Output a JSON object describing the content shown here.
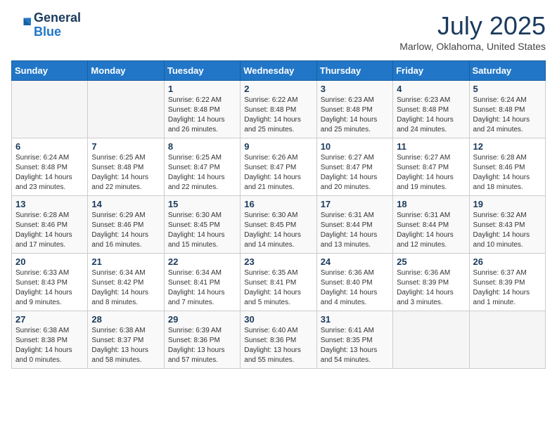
{
  "logo": {
    "text1": "General",
    "text2": "Blue"
  },
  "title": "July 2025",
  "location": "Marlow, Oklahoma, United States",
  "days_of_week": [
    "Sunday",
    "Monday",
    "Tuesday",
    "Wednesday",
    "Thursday",
    "Friday",
    "Saturday"
  ],
  "weeks": [
    [
      {
        "day": "",
        "info": ""
      },
      {
        "day": "",
        "info": ""
      },
      {
        "day": "1",
        "info": "Sunrise: 6:22 AM\nSunset: 8:48 PM\nDaylight: 14 hours and 26 minutes."
      },
      {
        "day": "2",
        "info": "Sunrise: 6:22 AM\nSunset: 8:48 PM\nDaylight: 14 hours and 25 minutes."
      },
      {
        "day": "3",
        "info": "Sunrise: 6:23 AM\nSunset: 8:48 PM\nDaylight: 14 hours and 25 minutes."
      },
      {
        "day": "4",
        "info": "Sunrise: 6:23 AM\nSunset: 8:48 PM\nDaylight: 14 hours and 24 minutes."
      },
      {
        "day": "5",
        "info": "Sunrise: 6:24 AM\nSunset: 8:48 PM\nDaylight: 14 hours and 24 minutes."
      }
    ],
    [
      {
        "day": "6",
        "info": "Sunrise: 6:24 AM\nSunset: 8:48 PM\nDaylight: 14 hours and 23 minutes."
      },
      {
        "day": "7",
        "info": "Sunrise: 6:25 AM\nSunset: 8:48 PM\nDaylight: 14 hours and 22 minutes."
      },
      {
        "day": "8",
        "info": "Sunrise: 6:25 AM\nSunset: 8:47 PM\nDaylight: 14 hours and 22 minutes."
      },
      {
        "day": "9",
        "info": "Sunrise: 6:26 AM\nSunset: 8:47 PM\nDaylight: 14 hours and 21 minutes."
      },
      {
        "day": "10",
        "info": "Sunrise: 6:27 AM\nSunset: 8:47 PM\nDaylight: 14 hours and 20 minutes."
      },
      {
        "day": "11",
        "info": "Sunrise: 6:27 AM\nSunset: 8:47 PM\nDaylight: 14 hours and 19 minutes."
      },
      {
        "day": "12",
        "info": "Sunrise: 6:28 AM\nSunset: 8:46 PM\nDaylight: 14 hours and 18 minutes."
      }
    ],
    [
      {
        "day": "13",
        "info": "Sunrise: 6:28 AM\nSunset: 8:46 PM\nDaylight: 14 hours and 17 minutes."
      },
      {
        "day": "14",
        "info": "Sunrise: 6:29 AM\nSunset: 8:46 PM\nDaylight: 14 hours and 16 minutes."
      },
      {
        "day": "15",
        "info": "Sunrise: 6:30 AM\nSunset: 8:45 PM\nDaylight: 14 hours and 15 minutes."
      },
      {
        "day": "16",
        "info": "Sunrise: 6:30 AM\nSunset: 8:45 PM\nDaylight: 14 hours and 14 minutes."
      },
      {
        "day": "17",
        "info": "Sunrise: 6:31 AM\nSunset: 8:44 PM\nDaylight: 14 hours and 13 minutes."
      },
      {
        "day": "18",
        "info": "Sunrise: 6:31 AM\nSunset: 8:44 PM\nDaylight: 14 hours and 12 minutes."
      },
      {
        "day": "19",
        "info": "Sunrise: 6:32 AM\nSunset: 8:43 PM\nDaylight: 14 hours and 10 minutes."
      }
    ],
    [
      {
        "day": "20",
        "info": "Sunrise: 6:33 AM\nSunset: 8:43 PM\nDaylight: 14 hours and 9 minutes."
      },
      {
        "day": "21",
        "info": "Sunrise: 6:34 AM\nSunset: 8:42 PM\nDaylight: 14 hours and 8 minutes."
      },
      {
        "day": "22",
        "info": "Sunrise: 6:34 AM\nSunset: 8:41 PM\nDaylight: 14 hours and 7 minutes."
      },
      {
        "day": "23",
        "info": "Sunrise: 6:35 AM\nSunset: 8:41 PM\nDaylight: 14 hours and 5 minutes."
      },
      {
        "day": "24",
        "info": "Sunrise: 6:36 AM\nSunset: 8:40 PM\nDaylight: 14 hours and 4 minutes."
      },
      {
        "day": "25",
        "info": "Sunrise: 6:36 AM\nSunset: 8:39 PM\nDaylight: 14 hours and 3 minutes."
      },
      {
        "day": "26",
        "info": "Sunrise: 6:37 AM\nSunset: 8:39 PM\nDaylight: 14 hours and 1 minute."
      }
    ],
    [
      {
        "day": "27",
        "info": "Sunrise: 6:38 AM\nSunset: 8:38 PM\nDaylight: 14 hours and 0 minutes."
      },
      {
        "day": "28",
        "info": "Sunrise: 6:38 AM\nSunset: 8:37 PM\nDaylight: 13 hours and 58 minutes."
      },
      {
        "day": "29",
        "info": "Sunrise: 6:39 AM\nSunset: 8:36 PM\nDaylight: 13 hours and 57 minutes."
      },
      {
        "day": "30",
        "info": "Sunrise: 6:40 AM\nSunset: 8:36 PM\nDaylight: 13 hours and 55 minutes."
      },
      {
        "day": "31",
        "info": "Sunrise: 6:41 AM\nSunset: 8:35 PM\nDaylight: 13 hours and 54 minutes."
      },
      {
        "day": "",
        "info": ""
      },
      {
        "day": "",
        "info": ""
      }
    ]
  ]
}
